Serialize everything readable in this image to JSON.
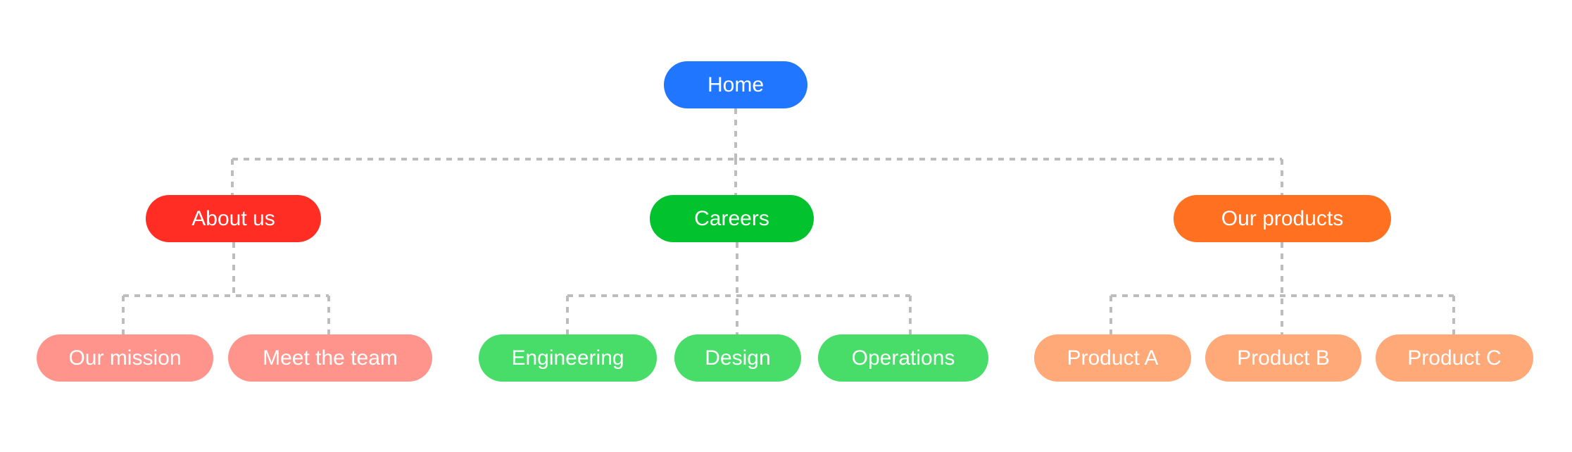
{
  "diagram": {
    "type": "sitemap-tree",
    "connector_color": "#BDBDBD",
    "root": {
      "id": "home",
      "label": "Home",
      "color": "#2176FF",
      "children": [
        {
          "id": "about",
          "label": "About us",
          "color": "#FF2D24",
          "children": [
            {
              "id": "mission",
              "label": "Our mission",
              "color": "#FF948C"
            },
            {
              "id": "team",
              "label": "Meet the team",
              "color": "#FF948C"
            }
          ]
        },
        {
          "id": "careers",
          "label": "Careers",
          "color": "#02C22D",
          "children": [
            {
              "id": "engineering",
              "label": "Engineering",
              "color": "#47DD68"
            },
            {
              "id": "design",
              "label": "Design",
              "color": "#47DD68"
            },
            {
              "id": "operations",
              "label": "Operations",
              "color": "#47DD68"
            }
          ]
        },
        {
          "id": "products",
          "label": "Our products",
          "color": "#FF7121",
          "children": [
            {
              "id": "product-a",
              "label": "Product A",
              "color": "#FFA878"
            },
            {
              "id": "product-b",
              "label": "Product B",
              "color": "#FFA878"
            },
            {
              "id": "product-c",
              "label": "Product C",
              "color": "#FFA878"
            }
          ]
        }
      ]
    }
  }
}
